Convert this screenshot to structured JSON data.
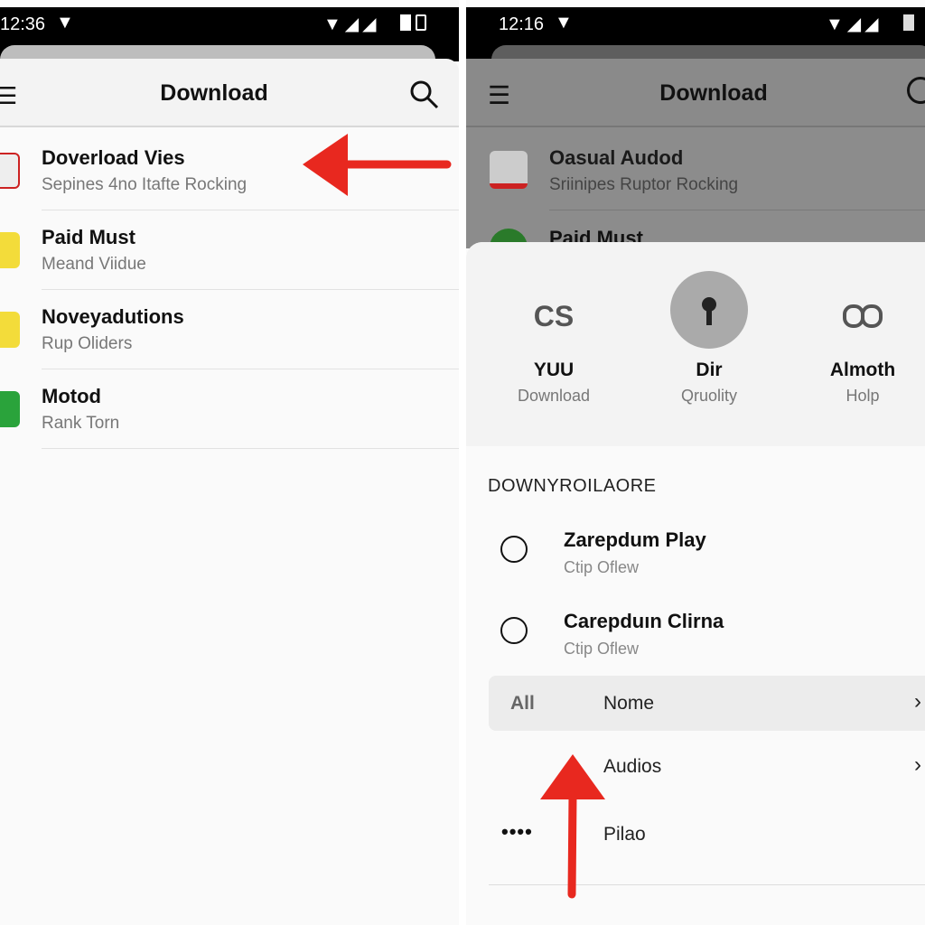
{
  "left": {
    "status": {
      "time": "12:36"
    },
    "header": {
      "title": "Download"
    },
    "items": [
      {
        "title": "Doverload Vies",
        "subtitle": "Sepines 4no Itafte Rocking"
      },
      {
        "title": "Paid Must",
        "subtitle": "Meand Viidue"
      },
      {
        "title": "Noveyadutions",
        "subtitle": "Rup Oliders"
      },
      {
        "title": "Motod",
        "subtitle": "Rank Torn"
      }
    ]
  },
  "right": {
    "status": {
      "time": "12:16"
    },
    "header": {
      "title": "Download"
    },
    "items": [
      {
        "title": "Oasual Audod",
        "subtitle": "Sriinipes Ruptor Rocking"
      },
      {
        "title": "Paid Must"
      }
    ],
    "sheet": {
      "options": [
        {
          "icon_text": "CS",
          "label": "YUU",
          "sublabel": "Download"
        },
        {
          "icon": "keyhole-icon",
          "label": "Dir",
          "sublabel": "Qruolity"
        },
        {
          "icon": "infinity-icon",
          "label": "Almoth",
          "sublabel": "Holp"
        }
      ],
      "section_title": "DOWNYROILAORE",
      "radios": [
        {
          "title": "Zarepdum Play",
          "subtitle": "Ctip Oflew"
        },
        {
          "title": "Carepduın Clirna",
          "subtitle": "Ctip Oflew"
        }
      ],
      "menu": [
        {
          "prefix": "All",
          "label": "Nome"
        },
        {
          "label": "Audios"
        },
        {
          "label": "Pilao"
        }
      ]
    }
  },
  "colors": {
    "arrow": "#e8281f"
  }
}
